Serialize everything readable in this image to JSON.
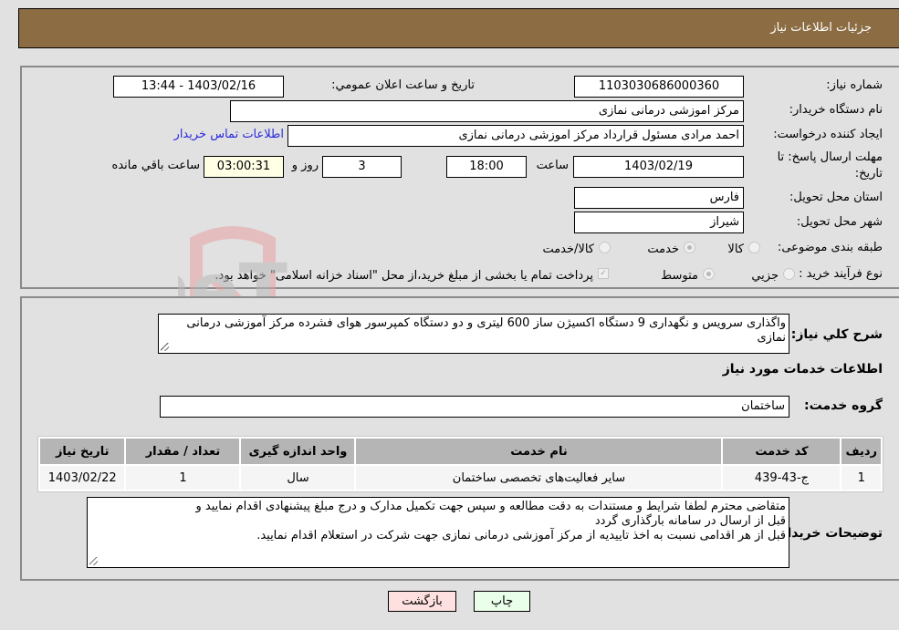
{
  "header": {
    "title": "جزئیات اطلاعات نیاز"
  },
  "details": {
    "need_number_label": "شماره نیاز:",
    "need_number": "1103030686000360",
    "announce_label": "تاریخ و ساعت اعلان عمومي:",
    "announce_value": "1403/02/16 - 13:44",
    "buyer_org_label": "نام دستگاه خریدار:",
    "buyer_org": "مرکز اموزشی درمانی نمازی",
    "creator_label": "ایجاد کننده درخواست:",
    "creator": "احمد مرادی مسئول قرارداد مرکز اموزشی درمانی نمازی",
    "contact_link": "اطلاعات تماس خریدار",
    "deadline_label": "مهلت ارسال پاسخ: تا تاریخ:",
    "deadline_date": "1403/02/19",
    "time_label": "ساعت",
    "deadline_time": "18:00",
    "days": "3",
    "days_label": "روز و",
    "remaining": "03:00:31",
    "remaining_label": "ساعت باقي مانده",
    "province_label": "استان محل تحویل:",
    "province": "فارس",
    "city_label": "شهر محل تحویل:",
    "city": "شیراز",
    "category_label": "طبقه بندی موضوعی:",
    "category_options": [
      {
        "label": "کالا",
        "selected": false
      },
      {
        "label": "خدمت",
        "selected": true
      },
      {
        "label": "کالا/خدمت",
        "selected": false
      }
    ],
    "process_label": "نوع فرآیند خرید :",
    "process_options": [
      {
        "label": "جزيي",
        "selected": false
      },
      {
        "label": "متوسط",
        "selected": true
      }
    ],
    "treasury_checked": true,
    "treasury_text": "پرداخت تمام یا بخشی از مبلغ خرید،از محل \"اسناد خزانه اسلامی\" خواهد بود."
  },
  "description": {
    "label": "شرح كلي نياز:",
    "text": "واگذاری سرویس و نگهداری 9 دستگاه اکسیژن ساز 600 لیتری و دو دستگاه کمپرسور هوای فشرده مرکز آموزشی درمانی نمازی"
  },
  "services": {
    "section_title": "اطلاعات خدمات مورد نیاز",
    "group_label": "گروه خدمت:",
    "group_value": "ساختمان",
    "columns": [
      "ردیف",
      "کد خدمت",
      "نام خدمت",
      "واحد اندازه گیری",
      "تعداد / مقدار",
      "تاریخ نیاز"
    ],
    "rows": [
      {
        "row": "1",
        "code": "ج-43-439",
        "name": "سایر فعالیت‌های تخصصی ساختمان",
        "unit": "سال",
        "qty": "1",
        "date": "1403/02/22"
      }
    ]
  },
  "buyer_notes": {
    "label": "توضیحات خریدار:",
    "lines": [
      "متقاضی محترم لطفا شرایط و مستندات به دقت مطالعه و سپس جهت تکمیل مدارک و درج مبلغ پیشنهادی اقدام نمایید و",
      "قبل از ارسال در سامانه بارگذاری گردد",
      "قبل از هر اقدامی نسبت به اخذ تاییدیه از مرکز آموزشی درمانی نمازی جهت شرکت در استعلام  اقدام نمایید."
    ]
  },
  "buttons": {
    "print": "چاپ",
    "back": "بازگشت"
  },
  "watermark": {
    "text": "AriaTender.neT"
  }
}
